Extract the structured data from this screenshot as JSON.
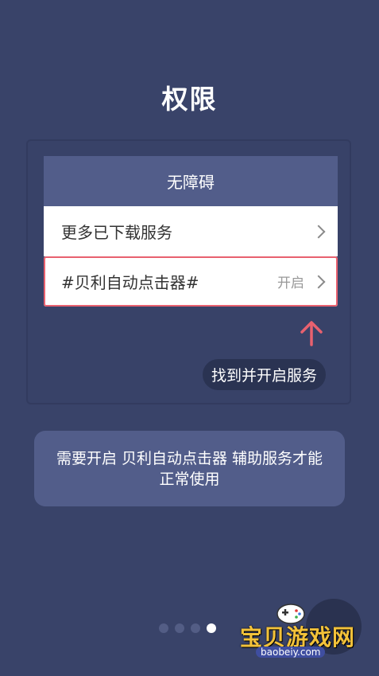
{
  "page": {
    "title": "权限"
  },
  "settings": {
    "header": "无障碍",
    "rows": [
      {
        "label": "更多已下载服务",
        "status": ""
      },
      {
        "label": "#贝利自动点击器#",
        "status": "开启"
      }
    ]
  },
  "hint": {
    "button_label": "找到并开启服务"
  },
  "notice": {
    "text": "需要开启 贝利自动点击器 辅助服务才能正常使用"
  },
  "pager": {
    "total": 4,
    "current": 4
  },
  "watermark": {
    "brand": "宝贝游戏网",
    "url": "baobeiy.com"
  },
  "colors": {
    "background": "#394369",
    "card_header": "#525d8a",
    "highlight": "#e8616f",
    "pill": "#2a3352"
  }
}
